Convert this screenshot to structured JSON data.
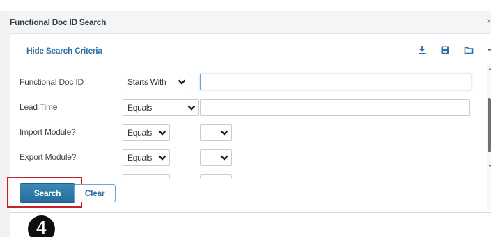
{
  "window": {
    "title": "Functional Doc ID Search",
    "close_glyph": "×"
  },
  "toolbar": {
    "hide_criteria_label": "Hide Search Criteria",
    "icons": [
      "download-icon",
      "save-icon",
      "folder-icon"
    ]
  },
  "form": {
    "rows": [
      {
        "label": "Functional Doc ID",
        "operator": "Starts With",
        "value": ""
      },
      {
        "label": "Lead Time",
        "operator": "Equals",
        "value": ""
      },
      {
        "label": "Import Module?",
        "operator": "Equals",
        "value": ""
      },
      {
        "label": "Export Module?",
        "operator": "Equals",
        "value": ""
      }
    ]
  },
  "actions": {
    "search_label": "Search",
    "clear_label": "Clear"
  },
  "annotation": {
    "step_number": "4",
    "highlight_color": "#c8202c"
  },
  "colors": {
    "primary_button": "#2a74a4",
    "link": "#2f6fa8",
    "focus_border": "#6a9fd8"
  }
}
